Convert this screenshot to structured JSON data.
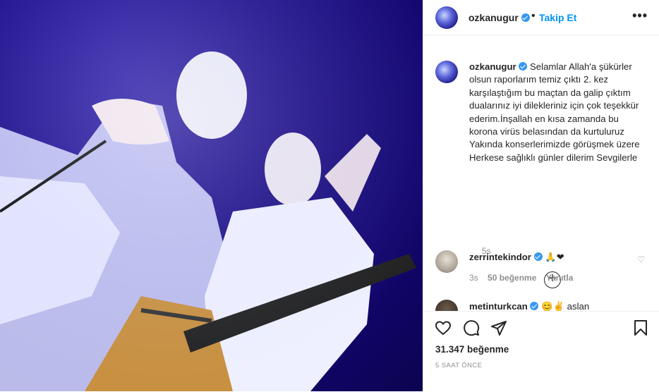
{
  "post": {
    "username": "ozkanugur",
    "follow_dot": "•",
    "follow_label": "Takip Et",
    "more_label": "•••",
    "caption": "Selamlar Allah'a şükürler olsun raporlarım temiz çıktı 2. kez karşılaştığım bu maçtan da galip çıktım dualarınız iyi dilekleriniz için çok teşekkür ederim.İnşallah en kısa zamanda bu korona virüs belasından da kurtuluruz Yakında konserlerimizde görüşmek üzere Herkese sağlıklı günler dilerim Sevgilerle",
    "caption_time": "5s",
    "load_more_symbol": "+",
    "likes": "31.347 beğenme",
    "time_ago": "5 SAAT ÖNCE"
  },
  "comments": [
    {
      "username": "zerrintekindor",
      "text": "🙏❤",
      "time": "3s",
      "likes": "50 beğenme",
      "reply": "Yanıtla"
    },
    {
      "username": "metinturkcan",
      "text": "😊✌ aslan"
    }
  ],
  "icons": {
    "like": "heart-icon",
    "comment": "comment-icon",
    "share": "share-icon",
    "save": "bookmark-icon"
  },
  "colors": {
    "accent": "#0095f6",
    "verified": "#3897f0",
    "heart": "#ed4956"
  }
}
